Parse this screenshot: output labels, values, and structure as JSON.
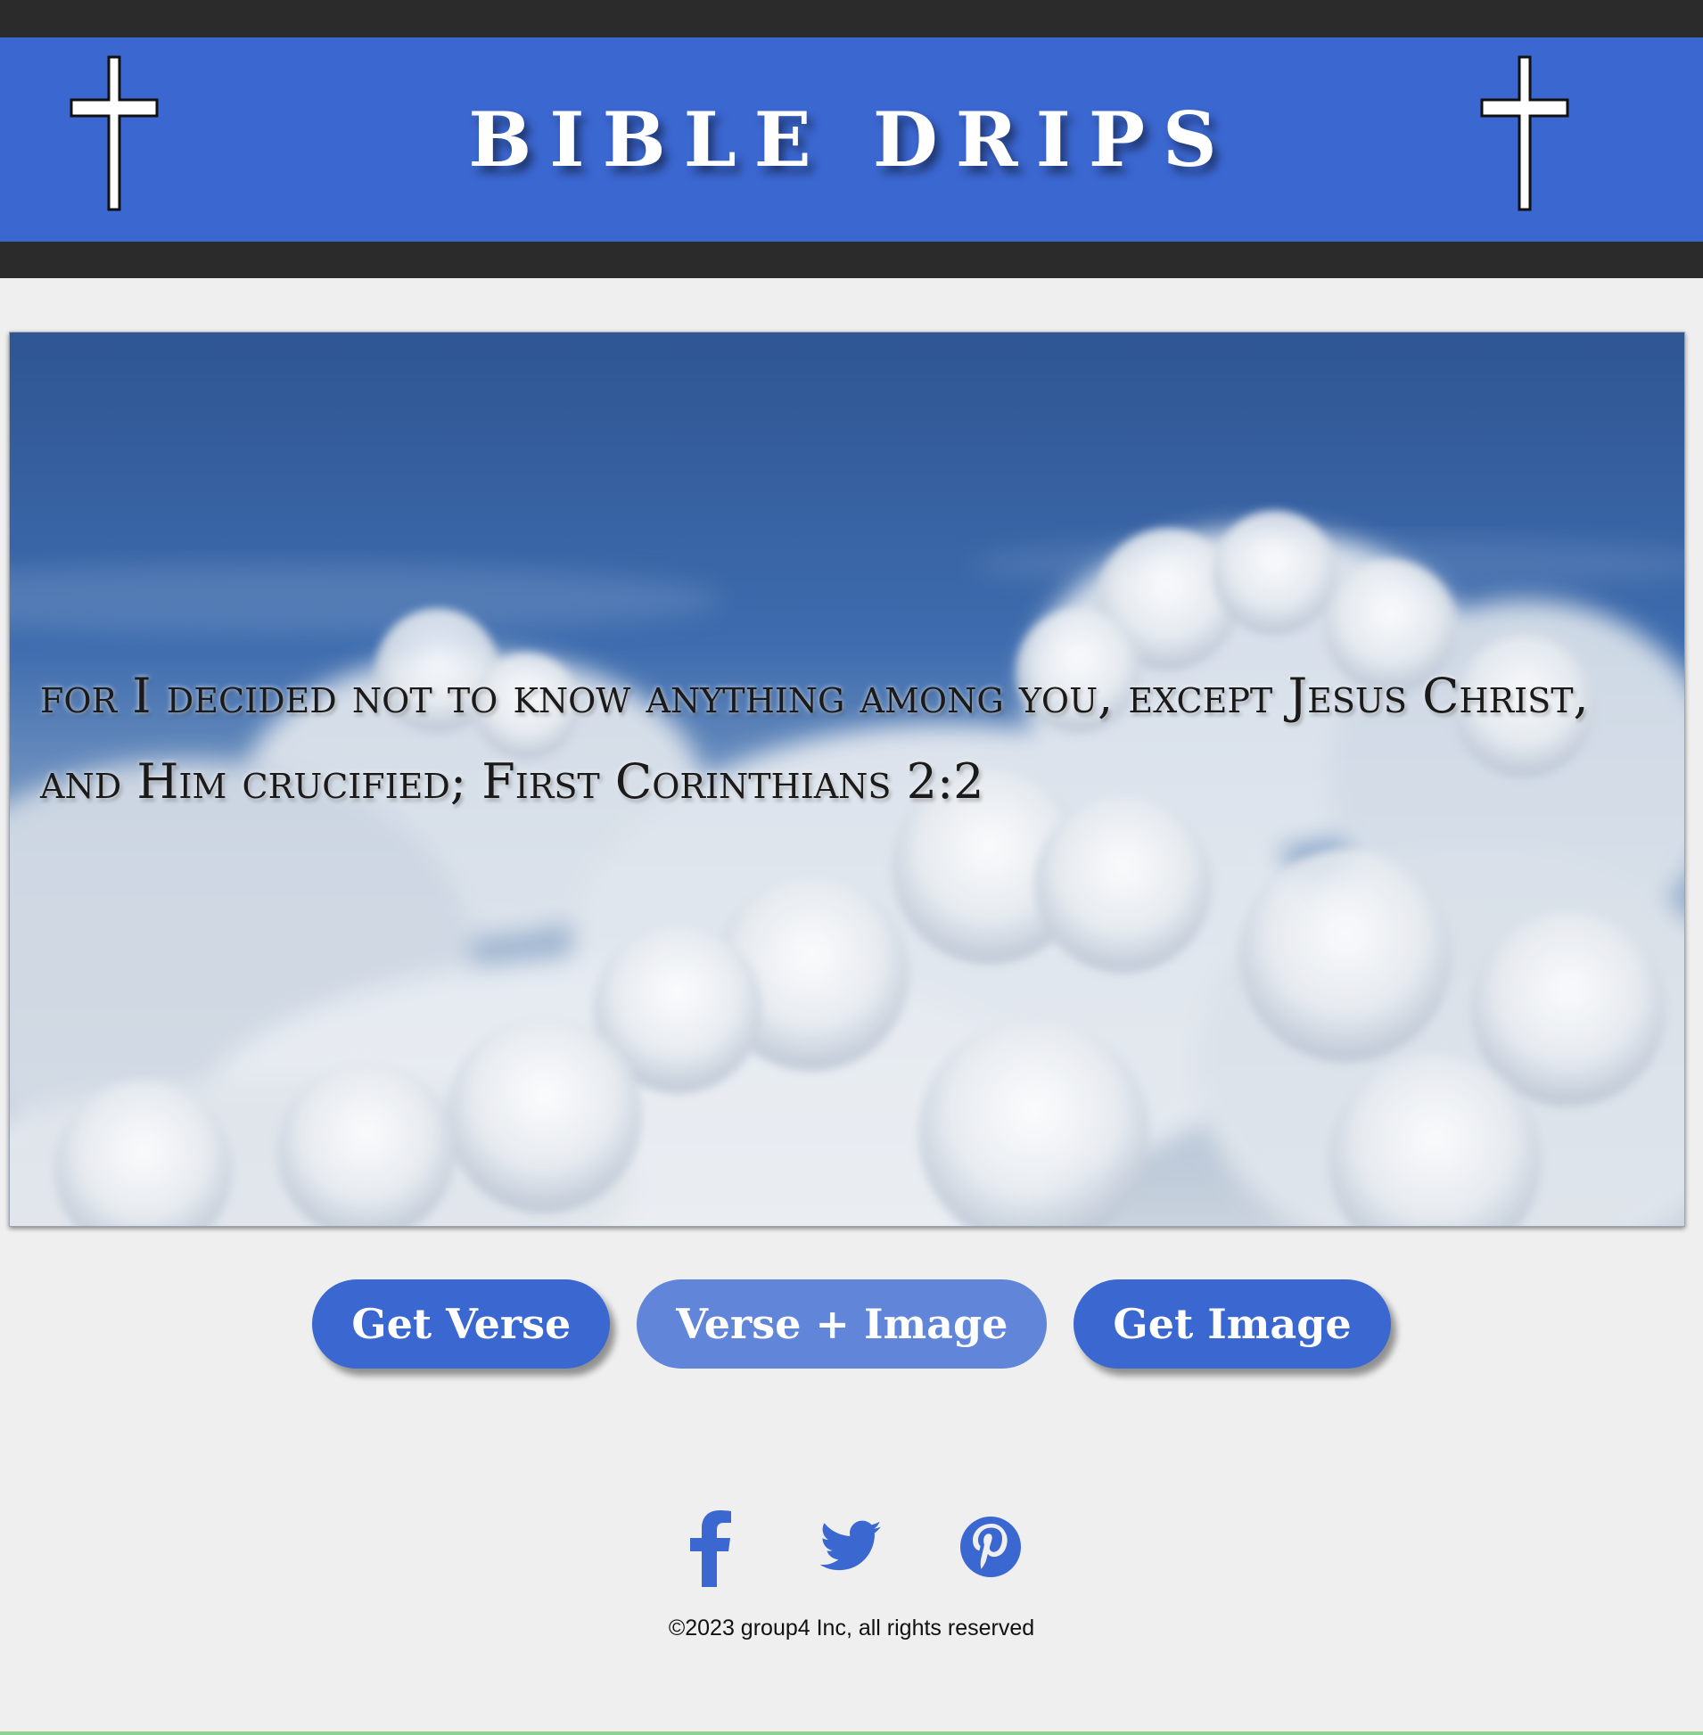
{
  "header": {
    "title": "BIBLE DRIPS"
  },
  "verse": {
    "text": "for I decided not to know anything among you, except Jesus Christ, and Him crucified; First Corinthians 2:2"
  },
  "buttons": {
    "get_verse": "Get Verse",
    "verse_image": "Verse + Image",
    "get_image": "Get Image"
  },
  "social": {
    "icons": [
      "facebook-icon",
      "twitter-icon",
      "pinterest-icon"
    ]
  },
  "footer": {
    "copyright": "©2023 group4 Inc, all rights reserved"
  },
  "colors": {
    "brand_blue": "#3b67d1",
    "button_secondary": "#6185d8",
    "dark_band": "#2b2b2b",
    "page_background": "#efefef"
  }
}
